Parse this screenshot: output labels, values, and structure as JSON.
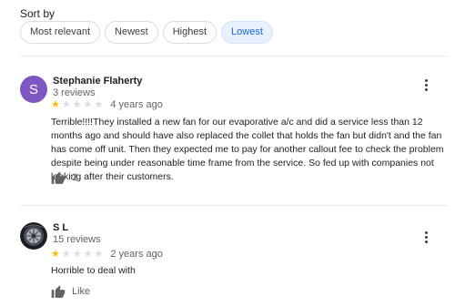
{
  "sort": {
    "label": "Sort by",
    "options": [
      "Most relevant",
      "Newest",
      "Highest",
      "Lowest"
    ],
    "selected": "Lowest"
  },
  "reviews": [
    {
      "author": "Stephanie Flaherty",
      "avatar_letter": "S",
      "review_count": "3 reviews",
      "rating": 1,
      "max_rating": 5,
      "date": "4 years ago",
      "text": "Terrible!!!!They installed a new fan for our evaporative a/c and did a service less than 12 months ago and should have also replaced the collet that holds the fan but didn't and the fan has come off unit. Then they expected me to pay for another callout fee to check the problem despite being under reasonable time frame from the service. So fed up with companies not looking after their customers.",
      "like_label": "2"
    },
    {
      "author": "S L",
      "avatar_image": "car-wheel",
      "review_count": "15 reviews",
      "rating": 1,
      "max_rating": 5,
      "date": "2 years ago",
      "text": "Horrible to deal with",
      "like_label": "Like"
    }
  ],
  "colors": {
    "accent": "#1967d2",
    "star": "#fbbc04",
    "avatar_bg": "#7e57c2"
  },
  "icons": {
    "like": "thumbs-up-icon",
    "more": "more-vert-icon"
  }
}
